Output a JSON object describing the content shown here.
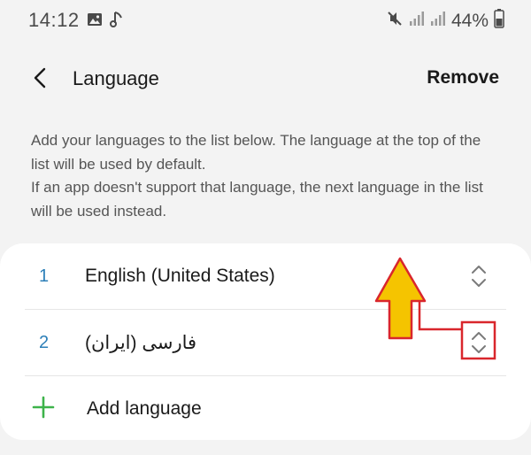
{
  "status_bar": {
    "time": "14:12",
    "left_icons": [
      "gallery-icon",
      "music-note-icon"
    ],
    "right_icons": [
      "mute-icon",
      "signal-icon",
      "signal-icon"
    ],
    "battery": "44%"
  },
  "header": {
    "title": "Language",
    "remove_label": "Remove"
  },
  "description": {
    "line1": "Add your languages to the list below. The language at the top of the list will be used by default.",
    "line2": "If an app doesn't support that language, the next language in the list will be used instead."
  },
  "languages": [
    {
      "index": "1",
      "name": "English (United States)"
    },
    {
      "index": "2",
      "name": "فارسی (ایران)"
    }
  ],
  "add_language_label": "Add language",
  "colors": {
    "background": "#f3f3f3",
    "card": "#ffffff",
    "index_blue": "#2c7fb8",
    "add_green": "#3db34a",
    "annotation_red": "#d9262c",
    "annotation_yellow": "#f5c400"
  }
}
